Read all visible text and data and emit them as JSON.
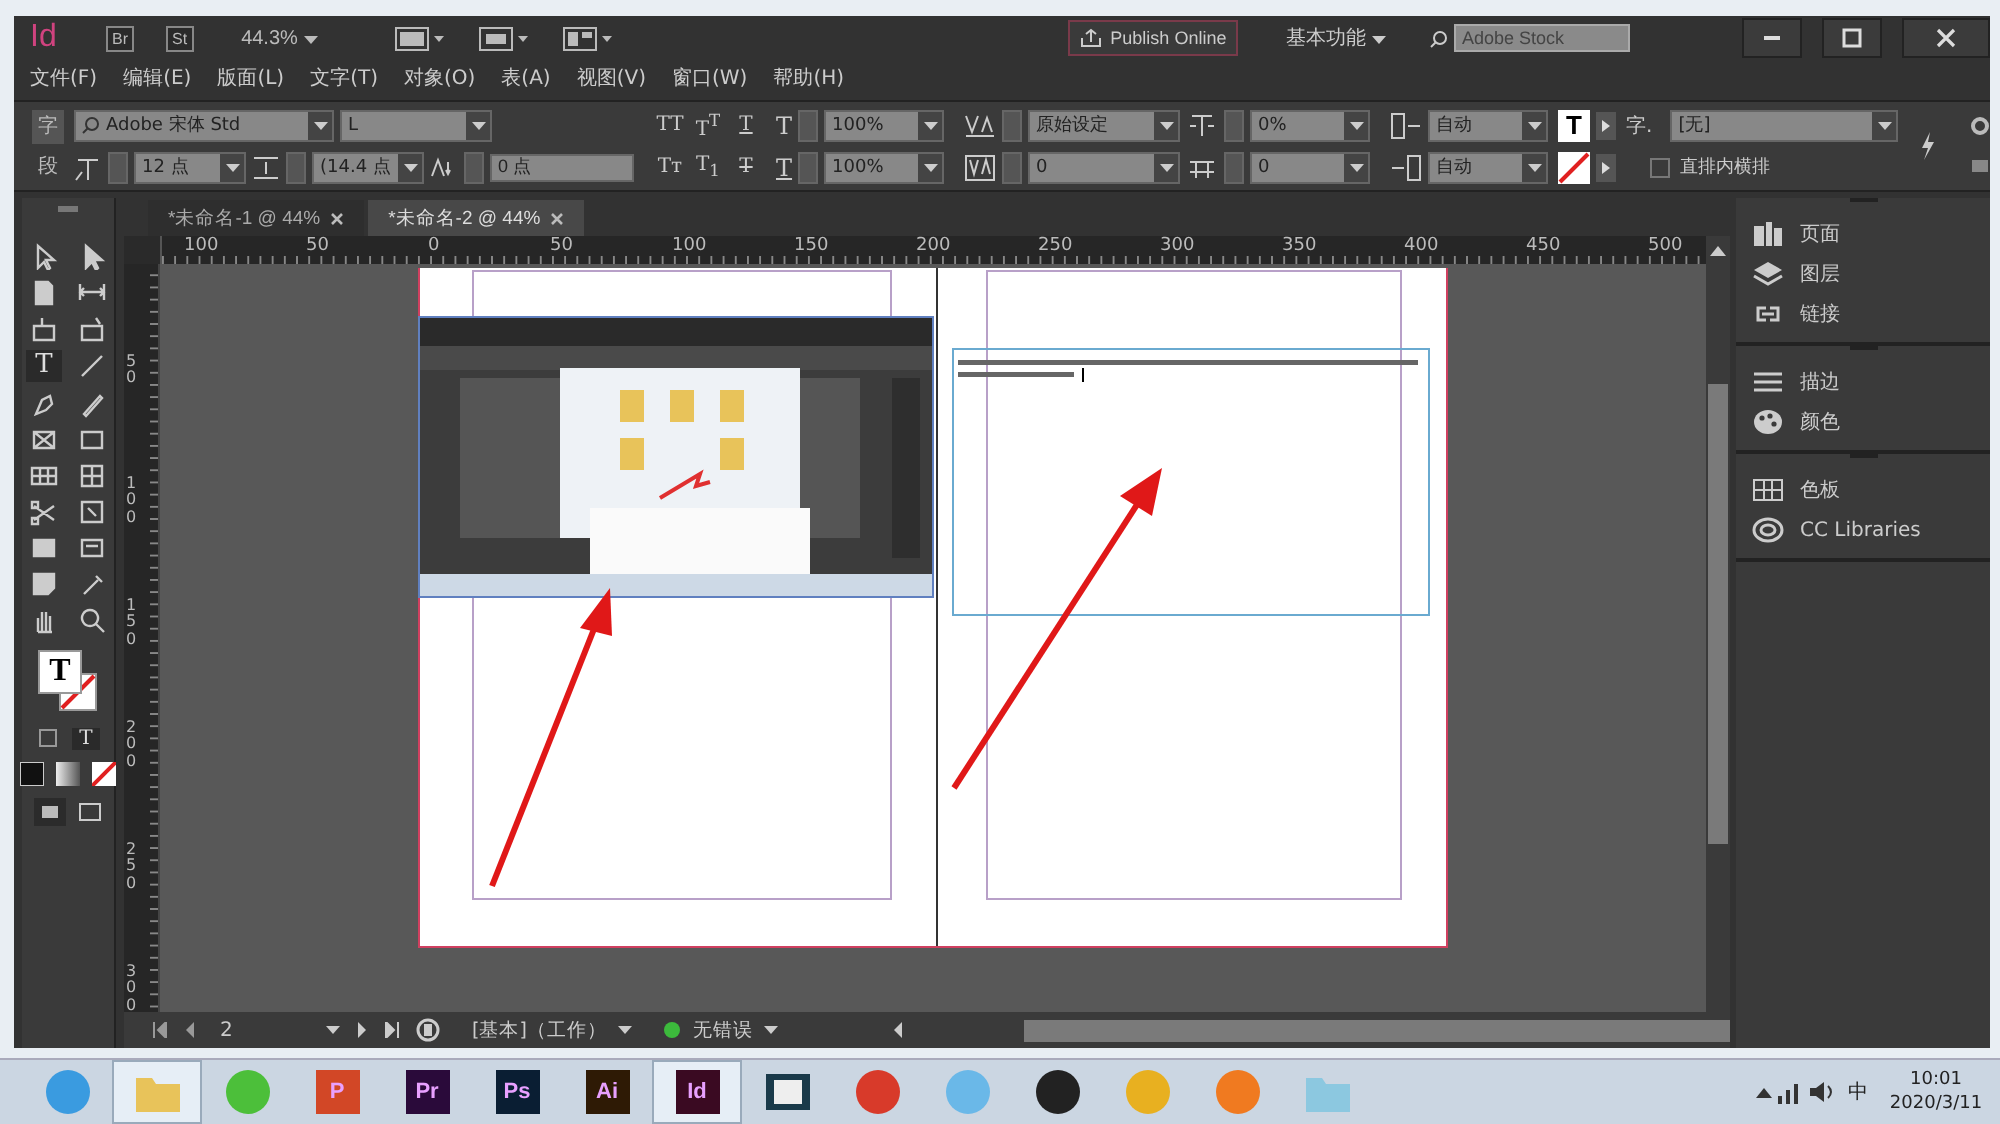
{
  "app": {
    "logo": "Id",
    "bridge": "Br",
    "stock": "St",
    "zoom": "44.3%",
    "publish": "Publish Online",
    "workspace": "基本功能",
    "search_placeholder": "Adobe Stock"
  },
  "menu": [
    "文件(F)",
    "编辑(E)",
    "版面(L)",
    "文字(T)",
    "对象(O)",
    "表(A)",
    "视图(V)",
    "窗口(W)",
    "帮助(H)"
  ],
  "control": {
    "char_mode": "字",
    "para_mode": "段",
    "font": "Adobe 宋体 Std",
    "style": "L",
    "size": "12 点",
    "leading": "(14.4 点",
    "baseline": "0 点",
    "case_top": [
      "TT",
      "T$^{T}$",
      "T"
    ],
    "case_bottom": [
      "Tт",
      "T$_{1}$",
      "T"
    ],
    "vscale_glyph": "T",
    "vscale": "100%",
    "hscale_glyph": "T",
    "hscale": "100%",
    "kerning": "原始设定",
    "tracking": "0",
    "tsume": "0%",
    "grid": "0",
    "auto_top": "自动",
    "auto_bottom": "自动",
    "fill_glyph": "T",
    "char_style_label": "字.",
    "char_style": "[无]",
    "tate": {
      "label": "直排内横排",
      "checked": false
    }
  },
  "tabs": [
    {
      "label": "*未命名-1 @ 44%",
      "selected": false
    },
    {
      "label": "*未命名-2 @ 44%",
      "selected": true
    }
  ],
  "toolbox": {
    "type_glyph": "T",
    "fill_glyph": "T",
    "format_glyph": "T"
  },
  "ruler": {
    "h": [
      "100",
      "50",
      "0",
      "50",
      "100",
      "150",
      "200",
      "250",
      "300",
      "350",
      "400",
      "450",
      "500"
    ],
    "v": [
      "50",
      "100",
      "150",
      "200",
      "250",
      "300"
    ]
  },
  "panels": [
    [
      {
        "label": "页面",
        "kind": "pages"
      },
      {
        "label": "图层",
        "kind": "layers"
      },
      {
        "label": "链接",
        "kind": "links"
      }
    ],
    [
      {
        "label": "描边",
        "kind": "stroke"
      },
      {
        "label": "颜色",
        "kind": "color"
      }
    ],
    [
      {
        "label": "色板",
        "kind": "swatches"
      },
      {
        "label": "CC Libraries",
        "kind": "cloud"
      }
    ]
  ],
  "status": {
    "page": "2",
    "style": "[基本]（工作）",
    "preflight": "无错误"
  },
  "taskbar": {
    "apps": [
      {
        "kind": "round",
        "color": "#3a9be0",
        "selected": false
      },
      {
        "kind": "folder",
        "color": "#e8c35a",
        "selected": true
      },
      {
        "kind": "round",
        "color": "#4cbf3a",
        "selected": false
      },
      {
        "kind": "tile",
        "label": "P",
        "color": "#d24726",
        "selected": false
      },
      {
        "kind": "tile",
        "label": "Pr",
        "color": "#2a0a3a",
        "selected": false
      },
      {
        "kind": "tile",
        "label": "Ps",
        "color": "#0a1e33",
        "selected": false
      },
      {
        "kind": "tile",
        "label": "Ai",
        "color": "#2e1a05",
        "selected": false
      },
      {
        "kind": "tile",
        "label": "Id",
        "color": "#3a0a22",
        "selected": true
      },
      {
        "kind": "film",
        "color": "#1a3a4a",
        "selected": false
      },
      {
        "kind": "round",
        "color": "#d83a2a",
        "selected": false
      },
      {
        "kind": "round",
        "color": "#6ab8e8",
        "selected": false
      },
      {
        "kind": "round",
        "color": "#222222",
        "selected": false
      },
      {
        "kind": "round",
        "color": "#e8b020",
        "selected": false
      },
      {
        "kind": "round",
        "color": "#f07a20",
        "selected": false
      },
      {
        "kind": "folder",
        "color": "#8cc8e0",
        "selected": false
      }
    ],
    "ime": "中",
    "time": "10:01",
    "date": "2020/3/11"
  }
}
